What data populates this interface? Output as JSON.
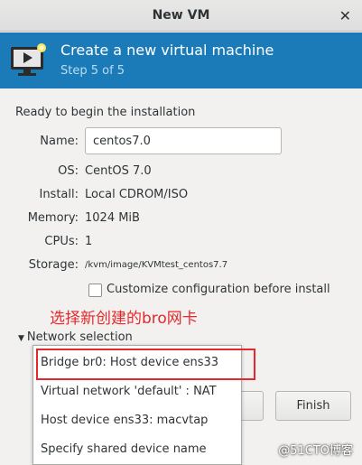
{
  "window": {
    "title": "New VM",
    "close_glyph": "✕"
  },
  "banner": {
    "icon": "vm-monitor-icon",
    "title": "Create a new virtual machine",
    "step": "Step 5 of 5",
    "bg_color": "#1b7bb8"
  },
  "summary": {
    "heading": "Ready to begin the installation",
    "name_label": "Name:",
    "name_value": "centos7.0",
    "os_label": "OS:",
    "os_value": "CentOS 7.0",
    "install_label": "Install:",
    "install_value": "Local CDROM/ISO",
    "memory_label": "Memory:",
    "memory_value": "1024 MiB",
    "cpus_label": "CPUs:",
    "cpus_value": "1",
    "storage_label": "Storage:",
    "storage_value": "/kvm/image/KVMtest_centos7.7"
  },
  "customize": {
    "label": "Customize configuration before install",
    "checked": false
  },
  "annotation": {
    "text": "选择新创建的bro网卡",
    "color": "#e5282b"
  },
  "network": {
    "expander_label": "Network selection",
    "options": [
      "Bridge br0: Host device ens33",
      "Virtual network 'default' : NAT",
      "Host device ens33: macvtap",
      "Specify shared device name"
    ],
    "highlighted_index": 0
  },
  "buttons": {
    "back": "",
    "finish": "Finish"
  },
  "watermark": "@51CTO博客"
}
